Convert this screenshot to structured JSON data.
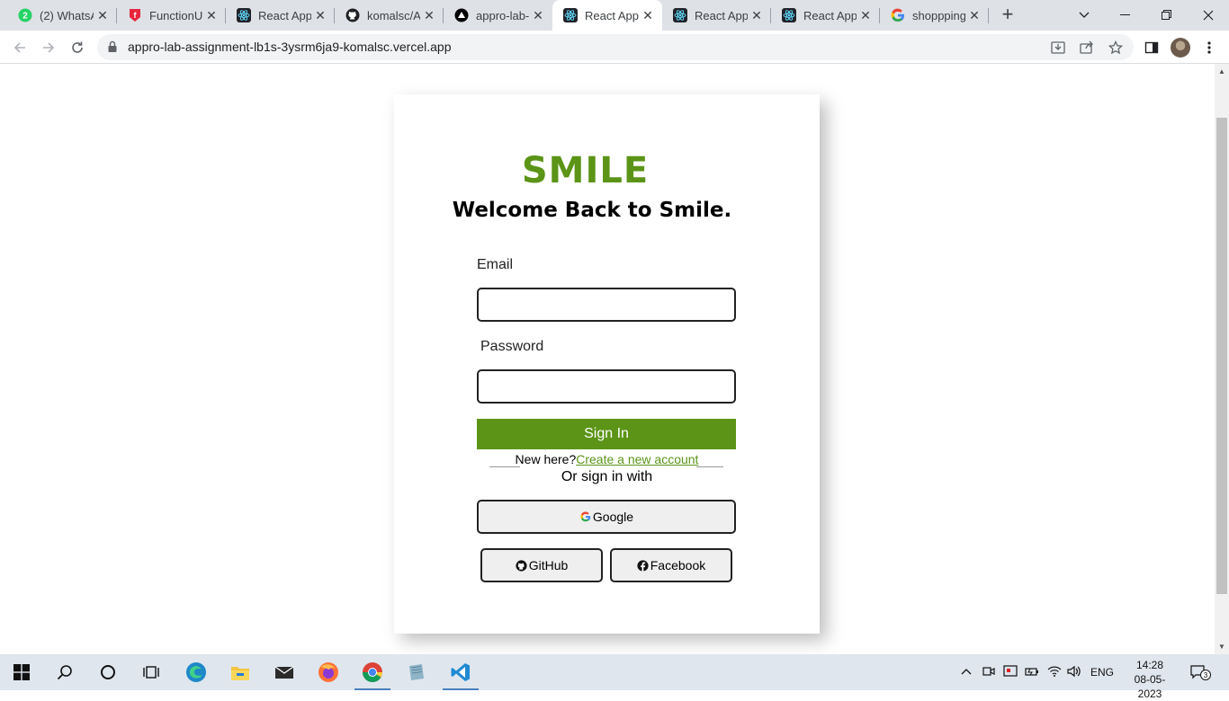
{
  "browser": {
    "tabs": [
      {
        "title": "(2) WhatsA",
        "icon": "whatsapp-icon"
      },
      {
        "title": "FunctionU",
        "icon": "functionup-icon"
      },
      {
        "title": "React App",
        "icon": "react-icon"
      },
      {
        "title": "komalsc/A",
        "icon": "github-icon"
      },
      {
        "title": "appro-lab-",
        "icon": "vercel-icon"
      },
      {
        "title": "React App",
        "icon": "react-icon",
        "active": true
      },
      {
        "title": "React App",
        "icon": "react-icon"
      },
      {
        "title": "React App",
        "icon": "react-icon"
      },
      {
        "title": "shoppping",
        "icon": "google-icon"
      }
    ],
    "url": "appro-lab-assignment-lb1s-3ysrm6ja9-komalsc.vercel.app"
  },
  "page": {
    "brand": "SMILE",
    "welcome": "Welcome Back to Smile.",
    "email_label": "Email",
    "password_label": "Password",
    "signin_label": "Sign In",
    "new_here": "New here?",
    "create_account": "Create a new account",
    "or_sign_in_with": "Or sign in with",
    "google_label": "Google",
    "github_label": "GitHub",
    "facebook_label": "Facebook",
    "accent_color": "#5b9417"
  },
  "taskbar": {
    "language": "ENG",
    "time": "14:28",
    "date": "08-05-2023",
    "notification_count": "3"
  }
}
